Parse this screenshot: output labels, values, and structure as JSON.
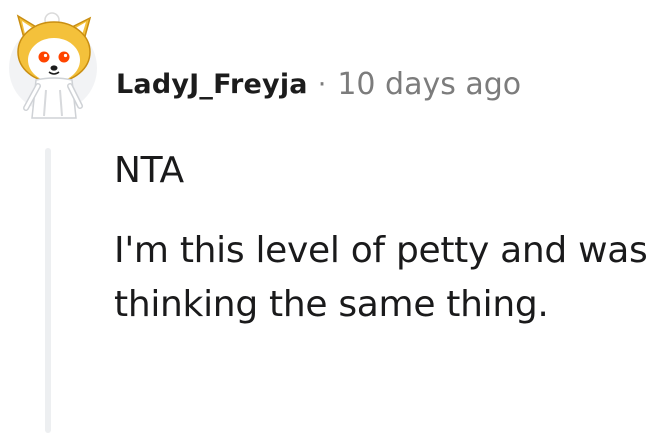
{
  "comment": {
    "author": {
      "username": "LadyJ_Freyja",
      "avatar_icon": "shiba-inu-snoo-avatar-icon"
    },
    "separator": "·",
    "timestamp": "10 days ago",
    "body": {
      "paragraphs": [
        "NTA",
        "I'm this level of petty and was thinking the same thing."
      ]
    }
  },
  "colors": {
    "username": "#1c1c1c",
    "meta_gray": "#7c7c7c",
    "thread_line": "#edeff1",
    "avatar_dog": "#f4c13b",
    "avatar_eyes": "#ff4500"
  }
}
